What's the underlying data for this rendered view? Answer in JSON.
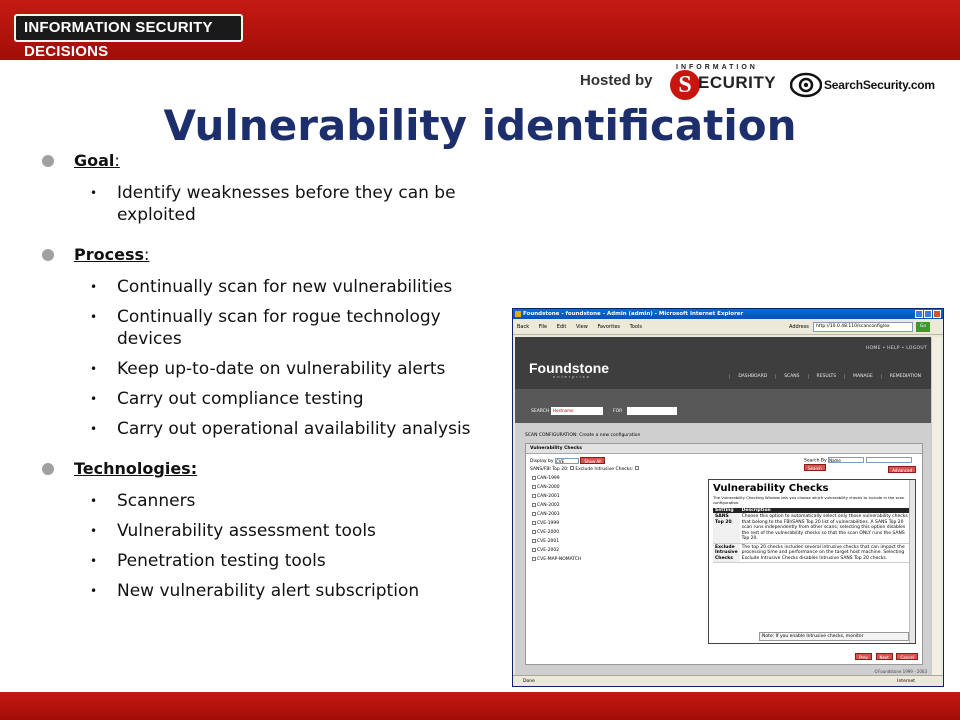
{
  "header": {
    "conference": "INFORMATION SECURITY DECISIONS",
    "hosted_by": "Hosted by",
    "sponsor1_top": "INFORMATION",
    "sponsor1_letter": "S",
    "sponsor1_name": "ECURITY",
    "sponsor2": "SearchSecurity.com"
  },
  "title": "Vulnerability identification",
  "bullets": {
    "goal_label": "Goal",
    "goal_items": [
      "Identify weaknesses before they can be exploited"
    ],
    "process_label": "Process",
    "process_items": [
      "Continually scan for new vulnerabilities",
      "Continually scan for rogue technology devices",
      "Keep up-to-date on vulnerability alerts",
      "Carry out compliance testing",
      "Carry out operational availability analysis"
    ],
    "tech_label": "Technologies:",
    "tech_items": [
      "Scanners",
      "Vulnerability assessment tools",
      "Penetration testing tools",
      "New vulnerability alert subscription"
    ]
  },
  "screenshot": {
    "window_title": "Foundstone - foundstone - Admin (admin) - Microsoft Internet Explorer",
    "menu": [
      "Back",
      "File",
      "Edit",
      "View",
      "Favorites",
      "Tools"
    ],
    "address_label": "Address",
    "address": "http://10.0.48.110/scanconfig/ex",
    "go": "Go",
    "top_links": "HOME  •  HELP  •  LOGOUT",
    "logo": "Foundstone",
    "logo_sub": "enterprise",
    "nav": [
      "DASHBOARD",
      "SCANS",
      "RESULTS",
      "MANAGE",
      "REMEDIATION"
    ],
    "search_label": "SEARCH",
    "search_value": "Hostname",
    "for_label": "FOR",
    "crumb": "SCAN CONFIGURATION: Create a new configuration",
    "panel_title": "Vulnerability Checks",
    "display_by_label": "Display by",
    "display_by_value": "CVE",
    "show_all": "Show All",
    "search_by_label": "Search By",
    "search_by_value": "Name",
    "search_btn": "Search",
    "advanced": "Advanced",
    "sans_label": "SANS/FBI Top 20:",
    "exclude_label": "Exclude Intrusive Checks:",
    "tree": [
      "CAN-1999",
      "CAN-2000",
      "CAN-2001",
      "CAN-2002",
      "CAN-2003",
      "CVE-1999",
      "CVE-2000",
      "CVE-2001",
      "CVE-2002",
      "CVE-MAP-NOMATCH"
    ],
    "help_title": "Vulnerability Checks",
    "help_intro": "The Vulnerability Checking Window lets you choose which vulnerability checks to include in the scan configuration.",
    "help_col1": "Setting",
    "help_col2": "Description",
    "help_rows": [
      {
        "k": "SANS Top 20",
        "v": "Choose this option to automatically select only those vulnerability checks that belong to the FBI/SANS Top 20 list of vulnerabilities. A SANS Top 20 scan runs independently from other scans; selecting this option disables the rest of the vulnerability checks so that the scan ONLY runs the SANS Top 20."
      },
      {
        "k": "Exclude Intrusive Checks",
        "v": "The top 20 checks includes several intrusive checks that can impact the processing time and performance on the target host machine. Selecting Exclude Intrusive Checks disables Intrusive SANS Top 20 checks."
      }
    ],
    "help_note": "Note: If you enable Intrusive checks, monitor",
    "footer_buttons": [
      "Prev",
      "Next",
      "Cancel"
    ],
    "copyright": "©Foundstone 1999 - 2003",
    "status_left": "Done",
    "status_zone": "Internet"
  }
}
